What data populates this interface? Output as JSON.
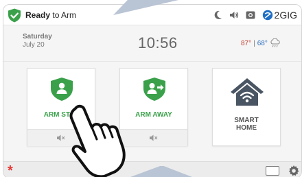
{
  "status": {
    "state_bold": "Ready",
    "state_rest": " to Arm",
    "brand": "2GIG",
    "icons": [
      "shield-check-icon",
      "moon-icon",
      "speaker-icon",
      "camera-icon",
      "brand-logo-icon"
    ]
  },
  "info": {
    "day": "Saturday",
    "date": "July 20",
    "time": "10:56",
    "temp_high": "87°",
    "temp_sep": " | ",
    "temp_low": "68°",
    "weather_icon": "rain-cloud-icon"
  },
  "tiles": [
    {
      "label": "ARM STAY",
      "icon": "shield-person-icon",
      "footer_icon": "speaker-mute-icon"
    },
    {
      "label": "ARM AWAY",
      "icon": "shield-person-arrow-icon",
      "footer_icon": "speaker-mute-icon"
    },
    {
      "label_line1": "SMART",
      "label_line2": "HOME",
      "icon": "house-wifi-icon"
    }
  ],
  "bottom": {
    "emergency_symbol": "*",
    "icons": [
      "emergency-icon",
      "keypad-icon",
      "gear-icon"
    ]
  },
  "colors": {
    "accent_green": "#3aa14a",
    "emergency_red": "#e53935",
    "temp_high": "#c0392b",
    "temp_low": "#2c6fbf",
    "house_gray": "#4a5563"
  }
}
